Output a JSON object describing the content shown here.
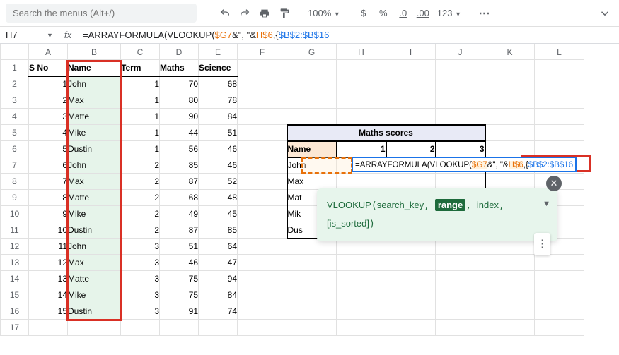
{
  "search_placeholder": "Search the menus (Alt+/)",
  "name_box": "H7",
  "formula": {
    "prefix": "=ARRAYFORMULA(VLOOKUP(",
    "ref1": "$G7",
    "mid1": "&\", \"&",
    "ref2": "H$6",
    "mid2": ",{",
    "ref3": "$B$2:$B$16"
  },
  "toolbar": {
    "zoom": "100%",
    "currency": "$",
    "percent": "%",
    "dec_dec": ".0",
    "dec_inc": ".00",
    "format": "123"
  },
  "columns": [
    "",
    "A",
    "B",
    "C",
    "D",
    "E",
    "F",
    "G",
    "H",
    "I",
    "J",
    "K",
    "L"
  ],
  "headers": {
    "A": "S No",
    "B": "Name",
    "C": "Term",
    "D": "Maths",
    "E": "Science"
  },
  "rows": [
    {
      "n": 1,
      "name": "John",
      "term": 1,
      "maths": 70,
      "science": 68
    },
    {
      "n": 2,
      "name": "Max",
      "term": 1,
      "maths": 80,
      "science": 78
    },
    {
      "n": 3,
      "name": "Matte",
      "term": 1,
      "maths": 90,
      "science": 84
    },
    {
      "n": 4,
      "name": "Mike",
      "term": 1,
      "maths": 44,
      "science": 51
    },
    {
      "n": 5,
      "name": "Dustin",
      "term": 1,
      "maths": 56,
      "science": 46
    },
    {
      "n": 6,
      "name": "John",
      "term": 2,
      "maths": 85,
      "science": 46
    },
    {
      "n": 7,
      "name": "Max",
      "term": 2,
      "maths": 87,
      "science": 52
    },
    {
      "n": 8,
      "name": "Matte",
      "term": 2,
      "maths": 68,
      "science": 48
    },
    {
      "n": 9,
      "name": "Mike",
      "term": 2,
      "maths": 49,
      "science": 45
    },
    {
      "n": 10,
      "name": "Dustin",
      "term": 2,
      "maths": 87,
      "science": 85
    },
    {
      "n": 11,
      "name": "John",
      "term": 3,
      "maths": 51,
      "science": 64
    },
    {
      "n": 12,
      "name": "Max",
      "term": 3,
      "maths": 46,
      "science": 47
    },
    {
      "n": 13,
      "name": "Matte",
      "term": 3,
      "maths": 75,
      "science": 94
    },
    {
      "n": 14,
      "name": "Mike",
      "term": 3,
      "maths": 75,
      "science": 84
    },
    {
      "n": 15,
      "name": "Dustin",
      "term": 3,
      "maths": 91,
      "science": 74
    }
  ],
  "mini_table": {
    "title": "Maths scores",
    "name_hdr": "Name",
    "cols": [
      1,
      2,
      3
    ],
    "names": [
      "John",
      "Max",
      "Mat",
      "Mik",
      "Dus"
    ]
  },
  "inline": {
    "prefix": "=ARRAYFORMULA(VLOOKUP(",
    "ref1": "$G7",
    "mid1": "&\", \"&",
    "ref2": "H$6",
    "mid2": ",{",
    "ref3": "$B$2:$B$16"
  },
  "tooltip": {
    "fn": "VLOOKUP",
    "p1": "search_key",
    "p2": "range",
    "p3": "index",
    "p4": "[is_sorted]"
  }
}
